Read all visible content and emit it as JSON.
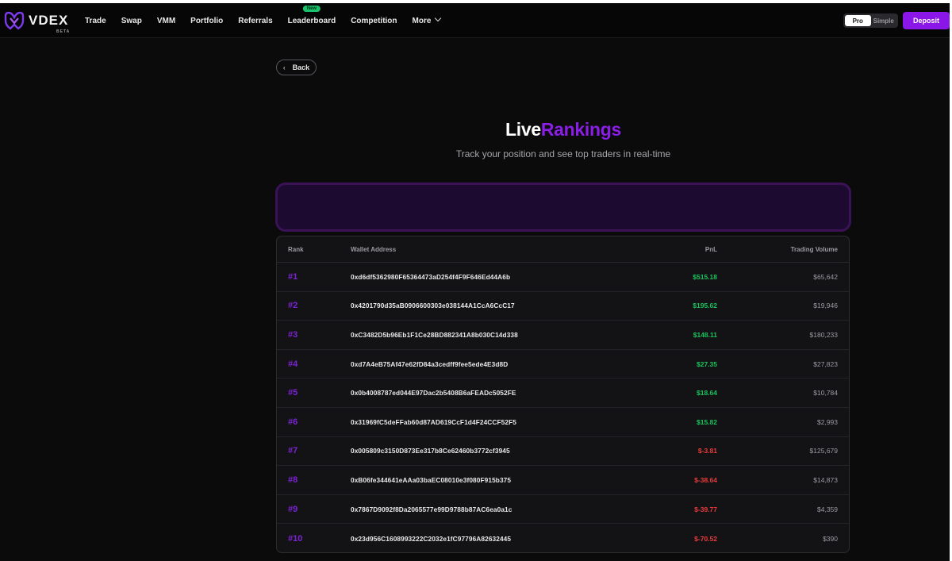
{
  "app": {
    "logo_text": "VDEX",
    "logo_tag": "BETA"
  },
  "nav": {
    "items": [
      {
        "label": "Trade"
      },
      {
        "label": "Swap"
      },
      {
        "label": "VMM"
      },
      {
        "label": "Portfolio"
      },
      {
        "label": "Referrals"
      },
      {
        "label": "Leaderboard",
        "badge": "New"
      },
      {
        "label": "Competition"
      },
      {
        "label": "More"
      }
    ]
  },
  "mode": {
    "pro": "Pro",
    "simple": "Simple",
    "selected": "Pro"
  },
  "deposit_label": "Deposit",
  "back_label": "Back",
  "hero": {
    "title_white": "Live",
    "title_purple": "Rankings",
    "subtitle": "Track your position and see top traders in real-time"
  },
  "table": {
    "headers": {
      "rank": "Rank",
      "wallet": "Wallet Address",
      "pnl": "PnL",
      "volume": "Trading Volume"
    },
    "rows": [
      {
        "rank": "#1",
        "wallet": "0xd6df5362980F65364473aD254f4F9F646Ed44A6b",
        "pnl": "$515.18",
        "volume": "$65,642",
        "sign": "pos"
      },
      {
        "rank": "#2",
        "wallet": "0x4201790d35aB0906600303e038144A1CcA6CcC17",
        "pnl": "$195.62",
        "volume": "$19,946",
        "sign": "pos"
      },
      {
        "rank": "#3",
        "wallet": "0xC3482D5b96Eb1F1Ce28BD882341A8b030C14d338",
        "pnl": "$148.11",
        "volume": "$180,233",
        "sign": "pos"
      },
      {
        "rank": "#4",
        "wallet": "0xd7A4eB75Af47e62fD84a3cedff9fee5ede4E3d8D",
        "pnl": "$27.35",
        "volume": "$27,823",
        "sign": "pos"
      },
      {
        "rank": "#5",
        "wallet": "0x0b4008787ed044E97Dac2b5408B6aFEADc5052FE",
        "pnl": "$18.64",
        "volume": "$10,784",
        "sign": "pos"
      },
      {
        "rank": "#6",
        "wallet": "0x31969fC5deFFab60d87AD619CcF1d4F24CCF52F5",
        "pnl": "$15.82",
        "volume": "$2,993",
        "sign": "pos"
      },
      {
        "rank": "#7",
        "wallet": "0x005809c3150D873Ee317b8Ce62460b3772cf3945",
        "pnl": "$-3.81",
        "volume": "$125,679",
        "sign": "neg"
      },
      {
        "rank": "#8",
        "wallet": "0xB06fe344641eAAa03baEC08010e3f080F915b375",
        "pnl": "$-38.64",
        "volume": "$14,873",
        "sign": "neg"
      },
      {
        "rank": "#9",
        "wallet": "0x7867D9092f8Da2065577e99D9788b87AC6ea0a1c",
        "pnl": "$-39.77",
        "volume": "$4,359",
        "sign": "neg"
      },
      {
        "rank": "#10",
        "wallet": "0x23d956C1608993222C2032e1fC97796A82632445",
        "pnl": "$-70.52",
        "volume": "$390",
        "sign": "neg"
      }
    ]
  },
  "colors": {
    "accent": "#8a16e8",
    "positive": "#19c45e",
    "negative": "#ee3b3b",
    "background": "#0b0b0c"
  }
}
